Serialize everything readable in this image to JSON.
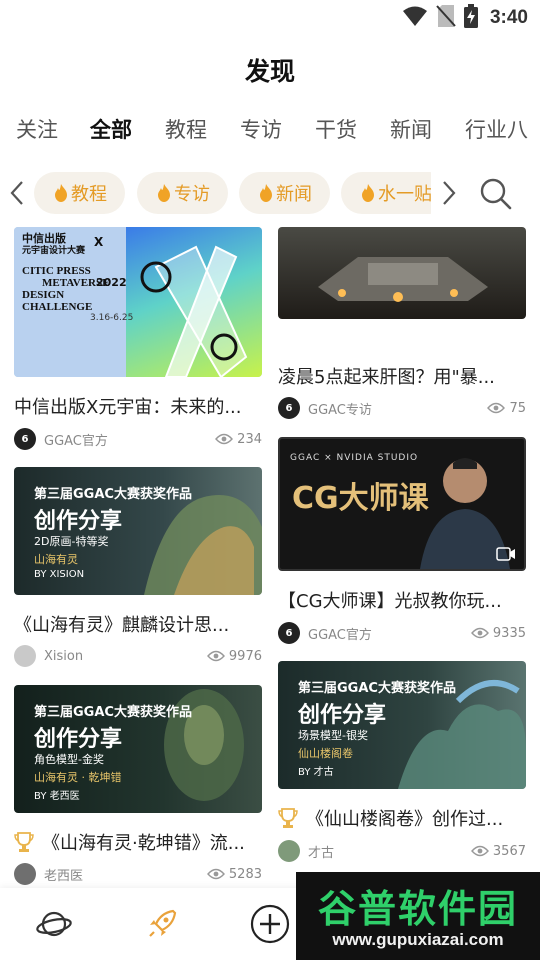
{
  "status_bar": {
    "time": "3:40"
  },
  "header": {
    "title": "发现"
  },
  "tabs": [
    "关注",
    "全部",
    "教程",
    "专访",
    "干货",
    "新闻",
    "行业八"
  ],
  "active_tab": "全部",
  "tags": [
    "教程",
    "专访",
    "新闻",
    "水一贴"
  ],
  "left_column": [
    {
      "title": "中信出版X元宇宙：未来的...",
      "author": "GGAC官方",
      "views": "234",
      "thumb": {
        "left": [
          "中信出版",
          "元宇宙设计大赛",
          "CITIC PRESS",
          "METAVERSE",
          "DESIGN",
          "CHALLENGE"
        ],
        "year": "2022",
        "right_top": "X",
        "dates": "3.16-6.25"
      }
    },
    {
      "title": "《山海有灵》麒麟设计思...",
      "author": "Xision",
      "views": "9976",
      "thumb": {
        "line1": "第三届GGAC大赛获奖作品",
        "line2": "创作分享",
        "line3": "2D原画-特等奖",
        "line4": "山海有灵",
        "line5": "BY XISION"
      }
    },
    {
      "title": "《山海有灵·乾坤错》流...",
      "author": "老西医",
      "views": "5283",
      "thumb": {
        "line1": "第三届GGAC大赛获奖作品",
        "line2": "创作分享",
        "line3": "角色模型-金奖",
        "line4": "山海有灵 · 乾坤错",
        "line5": "BY 老西医"
      }
    }
  ],
  "right_column": [
    {
      "title": "凌晨5点起来肝图？用\"暴...",
      "author": "GGAC专访",
      "views": "75"
    },
    {
      "title": "【CG大师课】光叔教你玩...",
      "author": "GGAC官方",
      "views": "9335",
      "thumb": {
        "top": "GGAC × NVIDIA STUDIO",
        "main": "CG大师课"
      }
    },
    {
      "title": "《仙山楼阁卷》创作过...",
      "author": "才古",
      "views": "3567",
      "thumb": {
        "line1": "第三届GGAC大赛获奖作品",
        "line2": "创作分享",
        "line3": "场景模型-银奖",
        "line4": "仙山楼阁卷",
        "line5": "BY 才古"
      }
    }
  ],
  "watermark": {
    "main": "谷普软件园",
    "url": "www.gupuxiazai.com"
  },
  "colors": {
    "accent": "#e49b26",
    "tag_bg": "#f5f1ea",
    "green": "#2fd06a"
  }
}
